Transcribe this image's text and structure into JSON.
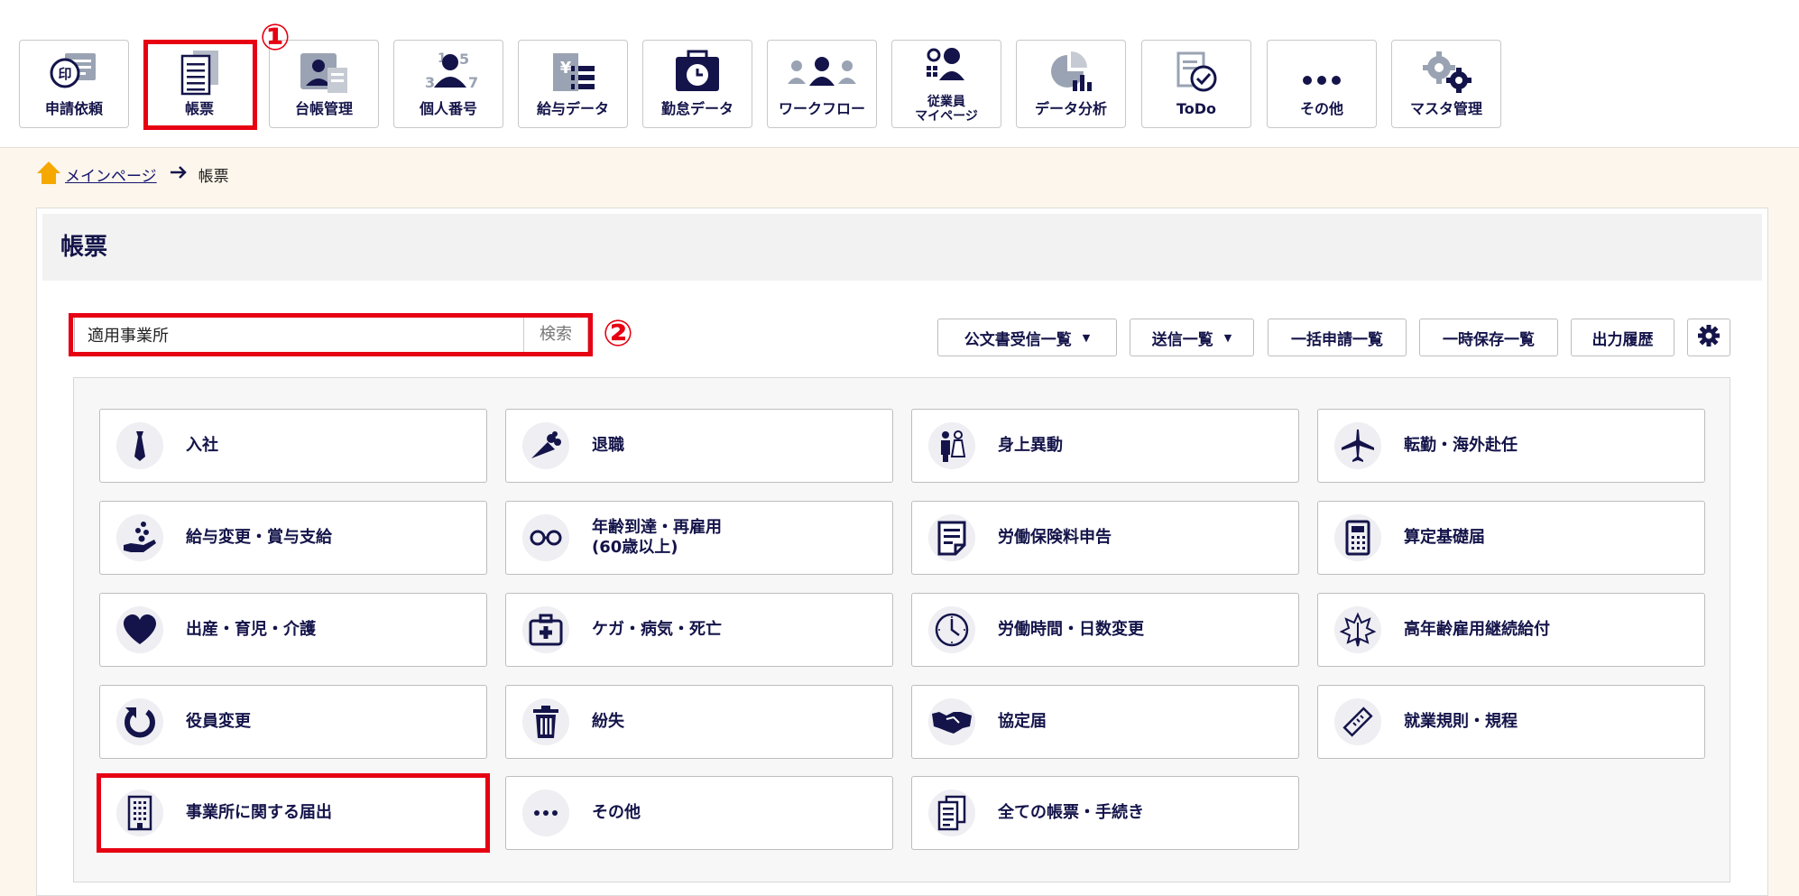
{
  "topnav": {
    "items": [
      {
        "label": "申請依頼",
        "icon": "stamp-icon"
      },
      {
        "label": "帳票",
        "icon": "document-icon"
      },
      {
        "label": "台帳管理",
        "icon": "ledger-icon"
      },
      {
        "label": "個人番号",
        "icon": "person-number-icon"
      },
      {
        "label": "給与データ",
        "icon": "salary-icon"
      },
      {
        "label": "勤怠データ",
        "icon": "attendance-icon"
      },
      {
        "label": "ワークフロー",
        "icon": "workflow-icon"
      },
      {
        "label": "従業員\nマイページ",
        "icon": "employee-page-icon"
      },
      {
        "label": "データ分析",
        "icon": "chart-icon"
      },
      {
        "label": "ToDo",
        "icon": "todo-icon"
      },
      {
        "label": "その他",
        "icon": "more-icon"
      },
      {
        "label": "マスタ管理",
        "icon": "gears-icon"
      }
    ]
  },
  "annotations": {
    "marker1": "①",
    "marker2": "②"
  },
  "breadcrumb": {
    "home": "メインページ",
    "current": "帳票"
  },
  "page": {
    "title": "帳票"
  },
  "search": {
    "value": "適用事業所",
    "button": "検索"
  },
  "toolbar": {
    "received": "公文書受信一覧",
    "sent": "送信一覧",
    "bulk": "一括申請一覧",
    "saved": "一時保存一覧",
    "history": "出力履歴"
  },
  "categories": [
    {
      "label": "入社",
      "icon": "tie-icon"
    },
    {
      "label": "退職",
      "icon": "bouquet-icon"
    },
    {
      "label": "身上異動",
      "icon": "couple-icon"
    },
    {
      "label": "転勤・海外赴任",
      "icon": "airplane-icon"
    },
    {
      "label": "給与変更・賞与支給",
      "icon": "coins-hand-icon"
    },
    {
      "label": "年齢到達・再雇用\n(60歳以上)",
      "icon": "glasses-icon"
    },
    {
      "label": "労働保険料申告",
      "icon": "form-icon"
    },
    {
      "label": "算定基礎届",
      "icon": "calculator-icon"
    },
    {
      "label": "出産・育児・介護",
      "icon": "heart-icon"
    },
    {
      "label": "ケガ・病気・死亡",
      "icon": "first-aid-icon"
    },
    {
      "label": "労働時間・日数変更",
      "icon": "clock-icon"
    },
    {
      "label": "高年齢雇用継続給付",
      "icon": "leaf-icon"
    },
    {
      "label": "役員変更",
      "icon": "refresh-icon"
    },
    {
      "label": "紛失",
      "icon": "trash-icon"
    },
    {
      "label": "協定届",
      "icon": "handshake-icon"
    },
    {
      "label": "就業規則・規程",
      "icon": "ruler-icon"
    },
    {
      "label": "事業所に関する届出",
      "icon": "building-icon"
    },
    {
      "label": "その他",
      "icon": "more-icon"
    },
    {
      "label": "全ての帳票・手続き",
      "icon": "documents-icon"
    }
  ],
  "colors": {
    "navy": "#14144a",
    "highlight": "#e60012",
    "home": "#f5a800"
  }
}
